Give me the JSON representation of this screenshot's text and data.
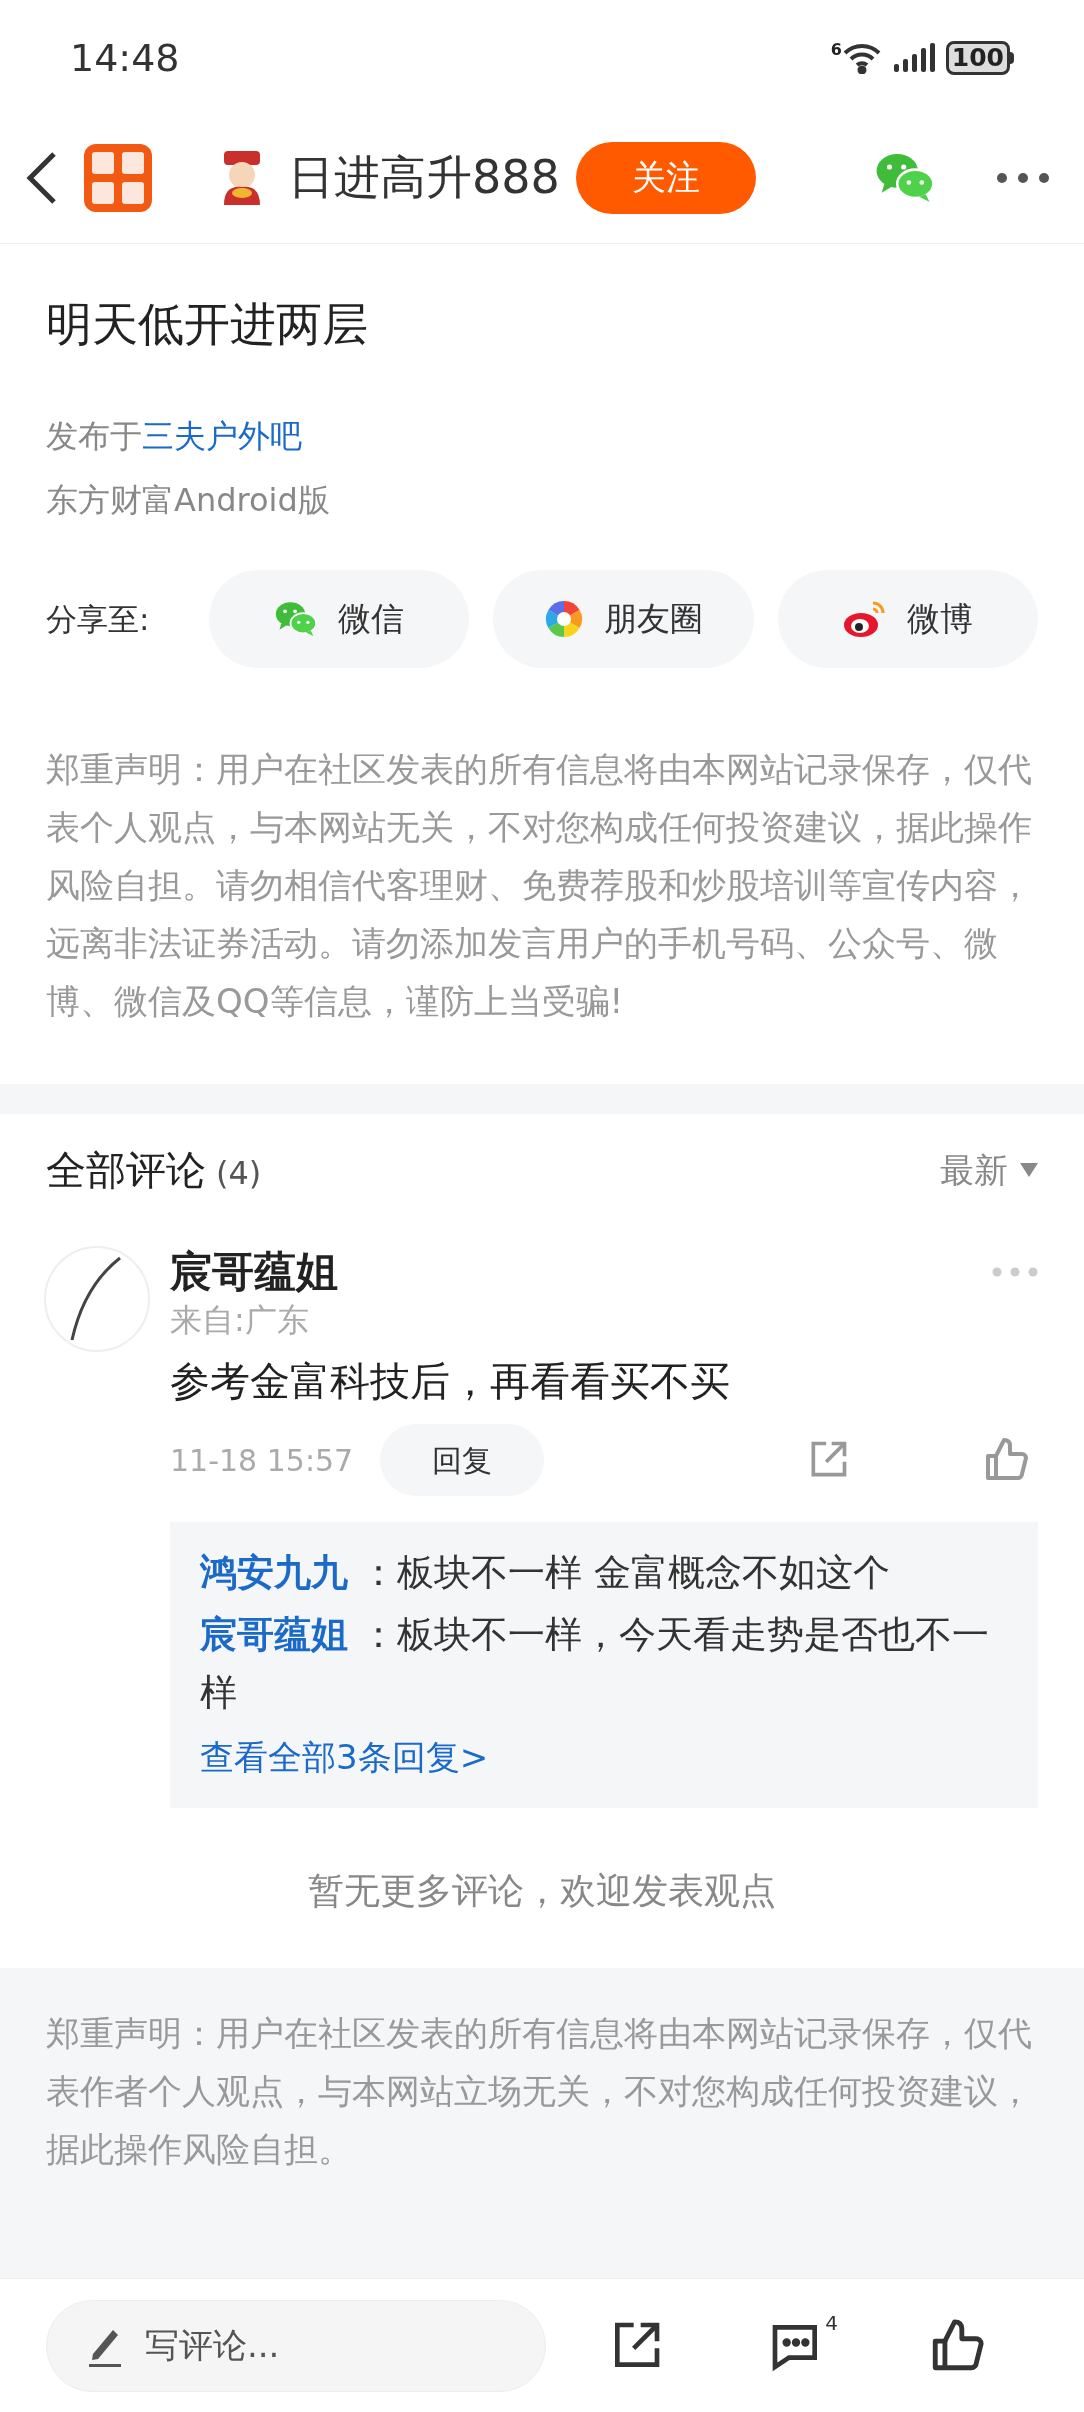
{
  "status_bar": {
    "time": "14:48",
    "network": "6",
    "battery": "100"
  },
  "nav": {
    "username": "日进高升888",
    "follow_button": "关注",
    "following": false
  },
  "post": {
    "title": "明天低开进两层",
    "published_prefix": "发布于",
    "bar_link": "三夫户外吧",
    "source": "东方财富Android版"
  },
  "share": {
    "label": "分享至:",
    "targets": [
      {
        "kind": "wechat",
        "label": "微信"
      },
      {
        "kind": "moments",
        "label": "朋友圈"
      },
      {
        "kind": "weibo",
        "label": "微博"
      }
    ]
  },
  "disclaimer": "郑重声明：用户在社区发表的所有信息将由本网站记录保存，仅代表个人观点，与本网站无关，不对您构成任何投资建议，据此操作风险自担。请勿相信代客理财、免费荐股和炒股培训等宣传内容，远离非法证券活动。请勿添加发言用户的手机号码、公众号、微博、微信及QQ等信息，谨防上当受骗!",
  "comments_header": {
    "title": "全部评论",
    "count": "(4)",
    "sort": "最新"
  },
  "comments": [
    {
      "author": "宸哥蕴姐",
      "location": "来自:广东",
      "text": "参考金富科技后，再看看买不买",
      "time": "11-18 15:57",
      "reply_button": "回复",
      "liked": false,
      "replies": [
        {
          "author": "鸿安九九",
          "text": "：板块不一样 金富概念不如这个"
        },
        {
          "author": "宸哥蕴姐",
          "text": "：板块不一样，今天看走势是否也不一样"
        }
      ],
      "view_all": "查看全部3条回复>"
    }
  ],
  "no_more": "暂无更多评论，欢迎发表观点",
  "footer_disclaimer": "郑重声明：用户在社区发表的所有信息将由本网站记录保存，仅代表作者个人观点，与本网站立场无关，不对您构成任何投资建议，据此操作风险自担。",
  "bottom_bar": {
    "placeholder": "写评论...",
    "comment_count": "4"
  }
}
